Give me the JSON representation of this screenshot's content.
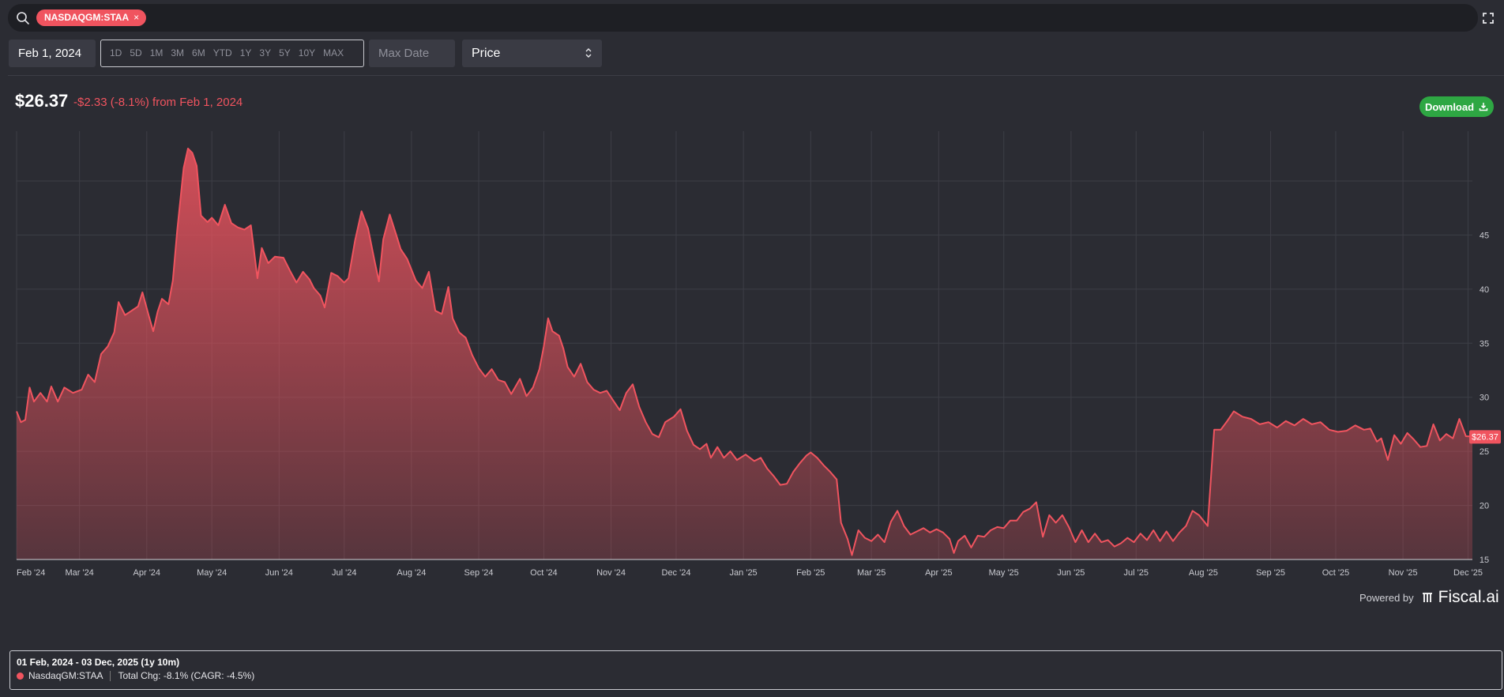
{
  "search": {
    "ticker_chip": "NASDAQGM:STAA",
    "chip_remove": "×"
  },
  "controls": {
    "date_from": "Feb 1, 2024",
    "ranges": [
      "1D",
      "5D",
      "1M",
      "3M",
      "6M",
      "YTD",
      "1Y",
      "3Y",
      "5Y",
      "10Y",
      "MAX"
    ],
    "date_max_placeholder": "Max Date",
    "metric_selected": "Price"
  },
  "header": {
    "price": "$26.37",
    "change": "-$2.33 (-8.1%) from Feb 1, 2024",
    "download_label": "Download"
  },
  "powered_by": {
    "label": "Powered by",
    "brand": "Fiscal.ai"
  },
  "summary": {
    "title": "01 Feb, 2024 - 03 Dec, 2025 (1y 10m)",
    "series": "NasdaqGM:STAA",
    "total_change": "Total Chg: -8.1% (CAGR: -4.5%)"
  },
  "colors": {
    "line": "#f0545f",
    "background": "#2b2c33",
    "accent_green": "#2ea743"
  },
  "chart_data": {
    "type": "area",
    "series": [
      {
        "name": "NasdaqGM:STAA",
        "last_value_label": "$26.37"
      }
    ],
    "x_start": "2024-02-01",
    "x_end": "2025-12-03",
    "x_tick_labels": [
      "Feb '24",
      "Mar '24",
      "Apr '24",
      "May '24",
      "Jun '24",
      "Jul '24",
      "Aug '24",
      "Sep '24",
      "Oct '24",
      "Nov '24",
      "Dec '24",
      "Jan '25",
      "Feb '25",
      "Mar '25",
      "Apr '25",
      "May '25",
      "Jun '25",
      "Jul '25",
      "Aug '25",
      "Sep '25",
      "Oct '25",
      "Nov '25",
      "Dec '25"
    ],
    "y_tick_labels": [
      "15",
      "20",
      "25",
      "30",
      "35",
      "40",
      "45"
    ],
    "y_ticks": [
      15,
      20,
      25,
      30,
      35,
      40,
      45
    ],
    "ylim": [
      15,
      54.6
    ],
    "grid": true,
    "points": [
      [
        "2024-02-01",
        28.7
      ],
      [
        "2024-02-03",
        27.7
      ],
      [
        "2024-02-05",
        27.9
      ],
      [
        "2024-02-07",
        30.9
      ],
      [
        "2024-02-09",
        29.6
      ],
      [
        "2024-02-12",
        30.4
      ],
      [
        "2024-02-15",
        29.6
      ],
      [
        "2024-02-17",
        31.0
      ],
      [
        "2024-02-20",
        29.6
      ],
      [
        "2024-02-23",
        30.9
      ],
      [
        "2024-02-27",
        30.4
      ],
      [
        "2024-03-02",
        30.7
      ],
      [
        "2024-03-05",
        32.1
      ],
      [
        "2024-03-08",
        31.4
      ],
      [
        "2024-03-11",
        34.0
      ],
      [
        "2024-03-14",
        34.7
      ],
      [
        "2024-03-17",
        36.0
      ],
      [
        "2024-03-19",
        38.8
      ],
      [
        "2024-03-22",
        37.6
      ],
      [
        "2024-03-25",
        38.0
      ],
      [
        "2024-03-28",
        38.4
      ],
      [
        "2024-03-30",
        39.7
      ],
      [
        "2024-04-02",
        37.5
      ],
      [
        "2024-04-04",
        36.1
      ],
      [
        "2024-04-06",
        37.9
      ],
      [
        "2024-04-08",
        39.1
      ],
      [
        "2024-04-11",
        38.6
      ],
      [
        "2024-04-13",
        40.8
      ],
      [
        "2024-04-15",
        45.4
      ],
      [
        "2024-04-18",
        51.2
      ],
      [
        "2024-04-20",
        53.0
      ],
      [
        "2024-04-22",
        52.6
      ],
      [
        "2024-04-24",
        51.4
      ],
      [
        "2024-04-26",
        46.8
      ],
      [
        "2024-04-29",
        46.2
      ],
      [
        "2024-05-01",
        46.6
      ],
      [
        "2024-05-04",
        45.9
      ],
      [
        "2024-05-07",
        47.8
      ],
      [
        "2024-05-10",
        46.1
      ],
      [
        "2024-05-13",
        45.7
      ],
      [
        "2024-05-16",
        45.5
      ],
      [
        "2024-05-19",
        45.9
      ],
      [
        "2024-05-22",
        41.0
      ],
      [
        "2024-05-24",
        43.8
      ],
      [
        "2024-05-27",
        42.4
      ],
      [
        "2024-05-30",
        43.0
      ],
      [
        "2024-06-03",
        42.9
      ],
      [
        "2024-06-06",
        41.7
      ],
      [
        "2024-06-09",
        40.6
      ],
      [
        "2024-06-12",
        41.6
      ],
      [
        "2024-06-15",
        40.9
      ],
      [
        "2024-06-17",
        40.1
      ],
      [
        "2024-06-20",
        39.4
      ],
      [
        "2024-06-22",
        38.3
      ],
      [
        "2024-06-25",
        41.5
      ],
      [
        "2024-06-28",
        41.2
      ],
      [
        "2024-07-01",
        40.6
      ],
      [
        "2024-07-03",
        41.0
      ],
      [
        "2024-07-06",
        44.5
      ],
      [
        "2024-07-09",
        47.2
      ],
      [
        "2024-07-12",
        45.6
      ],
      [
        "2024-07-15",
        42.6
      ],
      [
        "2024-07-17",
        40.7
      ],
      [
        "2024-07-19",
        44.6
      ],
      [
        "2024-07-22",
        46.9
      ],
      [
        "2024-07-25",
        45.0
      ],
      [
        "2024-07-27",
        43.7
      ],
      [
        "2024-07-30",
        42.8
      ],
      [
        "2024-08-03",
        40.8
      ],
      [
        "2024-08-06",
        40.1
      ],
      [
        "2024-08-09",
        41.6
      ],
      [
        "2024-08-12",
        38.0
      ],
      [
        "2024-08-15",
        37.7
      ],
      [
        "2024-08-18",
        40.2
      ],
      [
        "2024-08-20",
        37.3
      ],
      [
        "2024-08-23",
        36.0
      ],
      [
        "2024-08-26",
        35.5
      ],
      [
        "2024-08-29",
        33.9
      ],
      [
        "2024-09-01",
        32.7
      ],
      [
        "2024-09-04",
        31.9
      ],
      [
        "2024-09-07",
        32.6
      ],
      [
        "2024-09-10",
        31.6
      ],
      [
        "2024-09-13",
        31.4
      ],
      [
        "2024-09-16",
        30.3
      ],
      [
        "2024-09-20",
        31.7
      ],
      [
        "2024-09-23",
        30.1
      ],
      [
        "2024-09-26",
        30.9
      ],
      [
        "2024-09-29",
        32.6
      ],
      [
        "2024-10-01",
        34.7
      ],
      [
        "2024-10-03",
        37.3
      ],
      [
        "2024-10-05",
        36.1
      ],
      [
        "2024-10-08",
        35.7
      ],
      [
        "2024-10-10",
        34.5
      ],
      [
        "2024-10-12",
        32.8
      ],
      [
        "2024-10-15",
        31.9
      ],
      [
        "2024-10-18",
        33.1
      ],
      [
        "2024-10-21",
        31.4
      ],
      [
        "2024-10-24",
        30.7
      ],
      [
        "2024-10-27",
        30.4
      ],
      [
        "2024-10-30",
        30.6
      ],
      [
        "2024-11-02",
        29.7
      ],
      [
        "2024-11-05",
        28.8
      ],
      [
        "2024-11-08",
        30.4
      ],
      [
        "2024-11-11",
        31.2
      ],
      [
        "2024-11-14",
        29.1
      ],
      [
        "2024-11-17",
        27.7
      ],
      [
        "2024-11-20",
        26.6
      ],
      [
        "2024-11-23",
        26.3
      ],
      [
        "2024-11-26",
        27.7
      ],
      [
        "2024-11-30",
        28.2
      ],
      [
        "2024-12-03",
        28.9
      ],
      [
        "2024-12-06",
        26.9
      ],
      [
        "2024-12-09",
        25.6
      ],
      [
        "2024-12-12",
        25.2
      ],
      [
        "2024-12-15",
        25.7
      ],
      [
        "2024-12-17",
        24.4
      ],
      [
        "2024-12-20",
        25.4
      ],
      [
        "2024-12-23",
        24.4
      ],
      [
        "2024-12-26",
        25.0
      ],
      [
        "2024-12-29",
        24.2
      ],
      [
        "2025-01-02",
        24.7
      ],
      [
        "2025-01-06",
        24.1
      ],
      [
        "2025-01-09",
        24.4
      ],
      [
        "2025-01-12",
        23.4
      ],
      [
        "2025-01-15",
        22.7
      ],
      [
        "2025-01-18",
        21.9
      ],
      [
        "2025-01-21",
        22.0
      ],
      [
        "2025-01-24",
        23.1
      ],
      [
        "2025-01-27",
        23.9
      ],
      [
        "2025-01-30",
        24.6
      ],
      [
        "2025-02-01",
        24.9
      ],
      [
        "2025-02-04",
        24.4
      ],
      [
        "2025-02-07",
        23.7
      ],
      [
        "2025-02-10",
        23.1
      ],
      [
        "2025-02-13",
        22.4
      ],
      [
        "2025-02-15",
        18.4
      ],
      [
        "2025-02-18",
        16.9
      ],
      [
        "2025-02-20",
        15.4
      ],
      [
        "2025-02-23",
        17.7
      ],
      [
        "2025-02-26",
        17.0
      ],
      [
        "2025-03-01",
        16.7
      ],
      [
        "2025-03-04",
        17.3
      ],
      [
        "2025-03-07",
        16.6
      ],
      [
        "2025-03-10",
        18.5
      ],
      [
        "2025-03-13",
        19.5
      ],
      [
        "2025-03-16",
        18.1
      ],
      [
        "2025-03-19",
        17.3
      ],
      [
        "2025-03-22",
        17.6
      ],
      [
        "2025-03-25",
        17.9
      ],
      [
        "2025-03-28",
        17.5
      ],
      [
        "2025-03-31",
        17.8
      ],
      [
        "2025-04-03",
        17.5
      ],
      [
        "2025-04-06",
        16.9
      ],
      [
        "2025-04-08",
        15.6
      ],
      [
        "2025-04-10",
        16.7
      ],
      [
        "2025-04-13",
        17.2
      ],
      [
        "2025-04-16",
        16.1
      ],
      [
        "2025-04-19",
        17.2
      ],
      [
        "2025-04-22",
        17.1
      ],
      [
        "2025-04-25",
        17.7
      ],
      [
        "2025-04-28",
        18.0
      ],
      [
        "2025-05-01",
        17.9
      ],
      [
        "2025-05-04",
        18.6
      ],
      [
        "2025-05-07",
        18.6
      ],
      [
        "2025-05-10",
        19.4
      ],
      [
        "2025-05-13",
        19.7
      ],
      [
        "2025-05-16",
        20.3
      ],
      [
        "2025-05-19",
        17.1
      ],
      [
        "2025-05-22",
        19.1
      ],
      [
        "2025-05-25",
        18.4
      ],
      [
        "2025-05-28",
        19.1
      ],
      [
        "2025-05-31",
        18.0
      ],
      [
        "2025-06-03",
        16.6
      ],
      [
        "2025-06-06",
        17.7
      ],
      [
        "2025-06-09",
        16.6
      ],
      [
        "2025-06-12",
        17.4
      ],
      [
        "2025-06-15",
        16.6
      ],
      [
        "2025-06-18",
        16.8
      ],
      [
        "2025-06-21",
        16.2
      ],
      [
        "2025-06-24",
        16.5
      ],
      [
        "2025-06-27",
        17.0
      ],
      [
        "2025-06-30",
        16.6
      ],
      [
        "2025-07-03",
        17.4
      ],
      [
        "2025-07-06",
        16.8
      ],
      [
        "2025-07-09",
        17.7
      ],
      [
        "2025-07-12",
        16.7
      ],
      [
        "2025-07-15",
        17.6
      ],
      [
        "2025-07-18",
        16.7
      ],
      [
        "2025-07-21",
        17.5
      ],
      [
        "2025-07-24",
        18.1
      ],
      [
        "2025-07-27",
        19.5
      ],
      [
        "2025-07-30",
        19.1
      ],
      [
        "2025-08-03",
        18.1
      ],
      [
        "2025-08-06",
        27.0
      ],
      [
        "2025-08-09",
        27.0
      ],
      [
        "2025-08-12",
        27.8
      ],
      [
        "2025-08-15",
        28.7
      ],
      [
        "2025-08-19",
        28.2
      ],
      [
        "2025-08-23",
        28.0
      ],
      [
        "2025-08-27",
        27.5
      ],
      [
        "2025-08-31",
        27.7
      ],
      [
        "2025-09-04",
        27.2
      ],
      [
        "2025-09-08",
        27.8
      ],
      [
        "2025-09-12",
        27.4
      ],
      [
        "2025-09-16",
        28.0
      ],
      [
        "2025-09-20",
        27.5
      ],
      [
        "2025-09-24",
        27.7
      ],
      [
        "2025-09-28",
        27.0
      ],
      [
        "2025-10-02",
        26.8
      ],
      [
        "2025-10-06",
        26.9
      ],
      [
        "2025-10-10",
        27.4
      ],
      [
        "2025-10-14",
        27.0
      ],
      [
        "2025-10-17",
        27.1
      ],
      [
        "2025-10-20",
        25.9
      ],
      [
        "2025-10-22",
        26.2
      ],
      [
        "2025-10-25",
        24.2
      ],
      [
        "2025-10-28",
        26.5
      ],
      [
        "2025-10-31",
        25.7
      ],
      [
        "2025-11-03",
        26.7
      ],
      [
        "2025-11-06",
        26.1
      ],
      [
        "2025-11-09",
        25.4
      ],
      [
        "2025-11-12",
        25.5
      ],
      [
        "2025-11-15",
        27.5
      ],
      [
        "2025-11-18",
        26.0
      ],
      [
        "2025-11-21",
        26.6
      ],
      [
        "2025-11-24",
        26.2
      ],
      [
        "2025-11-27",
        28.0
      ],
      [
        "2025-11-30",
        26.4
      ],
      [
        "2025-12-03",
        26.37
      ]
    ]
  }
}
